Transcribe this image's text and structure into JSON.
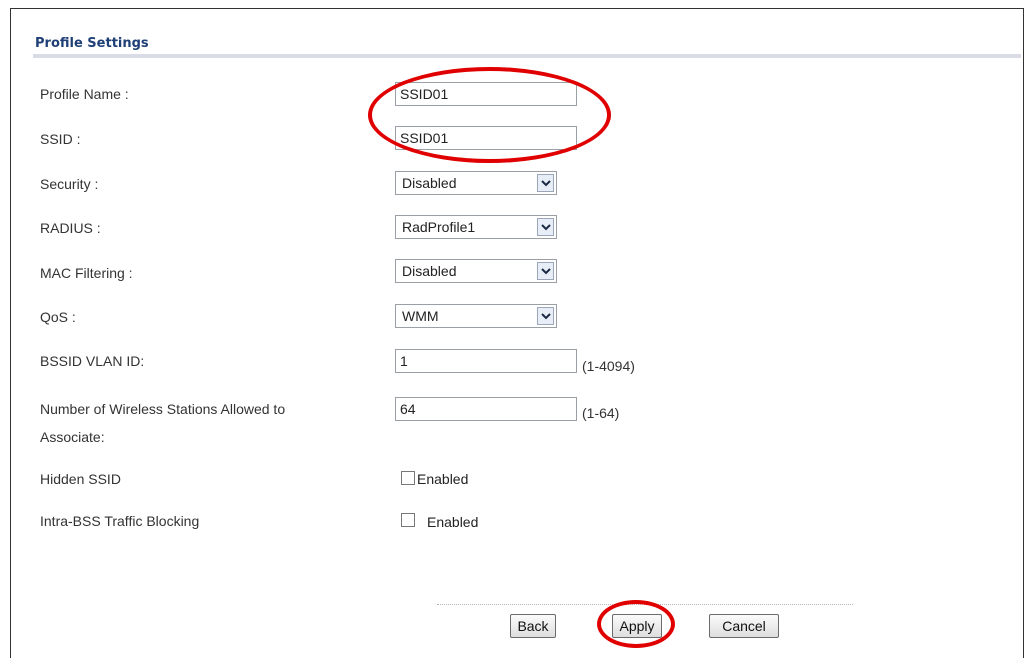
{
  "section": {
    "title": "Profile Settings"
  },
  "fields": {
    "profile_name": {
      "label": "Profile Name :",
      "value": "SSID01"
    },
    "ssid": {
      "label": "SSID :",
      "value": "SSID01"
    },
    "security": {
      "label": "Security :",
      "value": "Disabled"
    },
    "radius": {
      "label": "RADIUS :",
      "value": "RadProfile1"
    },
    "mac_filtering": {
      "label": "MAC Filtering :",
      "value": "Disabled"
    },
    "qos": {
      "label": "QoS :",
      "value": "WMM"
    },
    "bssid_vlan": {
      "label": "BSSID VLAN ID:",
      "value": "1",
      "range": "(1-4094)"
    },
    "stations": {
      "label_line1": "Number of Wireless Stations Allowed to",
      "label_line2": "Associate:",
      "value": "64",
      "range": "(1-64)"
    },
    "hidden_ssid": {
      "label": "Hidden SSID",
      "checkbox_label": "Enabled",
      "checked": false
    },
    "intra_bss": {
      "label": "Intra-BSS Traffic Blocking",
      "checkbox_label": "Enabled",
      "checked": false
    }
  },
  "buttons": {
    "back": "Back",
    "apply": "Apply",
    "cancel": "Cancel"
  },
  "colors": {
    "title": "#1f3f77",
    "highlight": "#e00000"
  }
}
